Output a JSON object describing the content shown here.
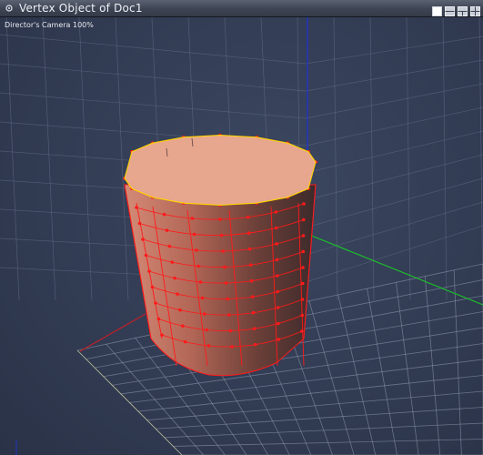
{
  "window": {
    "title": "Vertex Object of Doc1"
  },
  "viewport": {
    "camera_label": "Director's Camera 100%",
    "background_color": "#323c53",
    "grid_color": "#6b7690",
    "axis_colors": {
      "x": "#c0202a",
      "y": "#1cbf2a",
      "z": "#2233c8"
    }
  },
  "layout_buttons": [
    {
      "name": "single-view",
      "selected": true
    },
    {
      "name": "two-views"
    },
    {
      "name": "three-views"
    },
    {
      "name": "four-views"
    }
  ],
  "object": {
    "shape": "cylinder",
    "body_color": "#c97f6c",
    "cap_color": "#e7a68e",
    "vertex_color": "#ff1a1a",
    "edge_highlight_color": "#ffd200"
  }
}
